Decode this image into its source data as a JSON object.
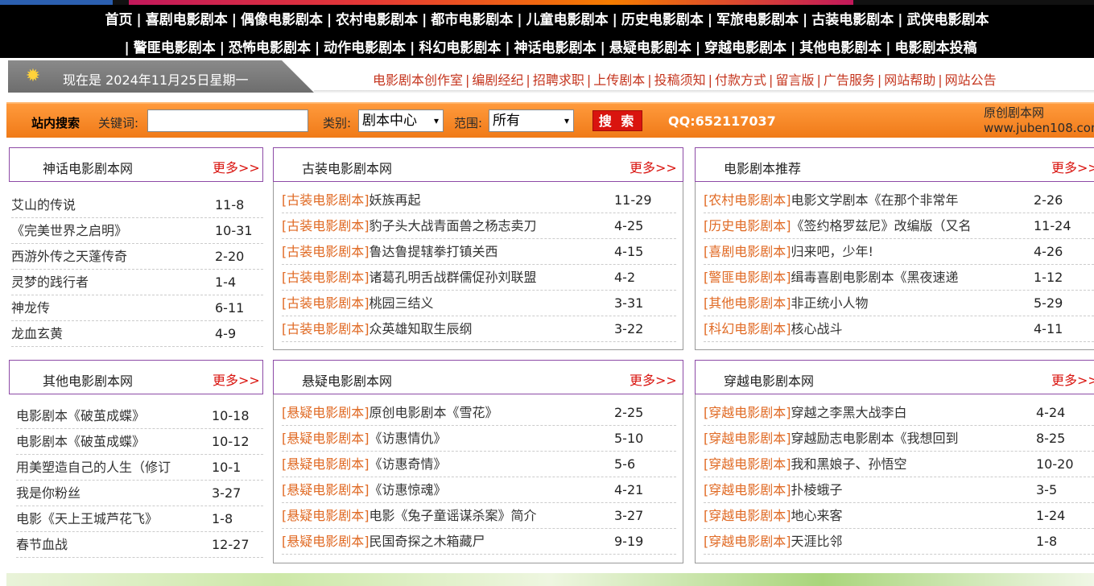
{
  "nav": {
    "row1": [
      "首页",
      "喜剧电影剧本",
      "偶像电影剧本",
      "农村电影剧本",
      "都市电影剧本",
      "儿童电影剧本",
      "历史电影剧本",
      "军旅电影剧本",
      "古装电影剧本",
      "武侠电影剧本"
    ],
    "row2": [
      "警匪电影剧本",
      "恐怖电影剧本",
      "动作电影剧本",
      "科幻电影剧本",
      "神话电影剧本",
      "悬疑电影剧本",
      "穿越电影剧本",
      "其他电影剧本",
      "电影剧本投稿"
    ]
  },
  "datebar": {
    "date_text": "现在是 2024年11月25日星期一",
    "links": [
      "电影剧本创作室",
      "编剧经纪",
      "招聘求职",
      "上传剧本",
      "投稿须知",
      "付款方式",
      "留言版",
      "广告服务",
      "网站帮助",
      "网站公告"
    ]
  },
  "search": {
    "site_search_label": "站内搜索",
    "keyword_label": "关键词:",
    "keyword_value": "",
    "category_label": "类别:",
    "category_value": "剧本中心",
    "scope_label": "范围:",
    "scope_value": "所有",
    "button_label": "搜 索",
    "qq": "QQ:652117037",
    "site_name": "原创剧本网",
    "site_url": "www.juben108.com"
  },
  "boxes": {
    "shenhua": {
      "title": "神话电影剧本网",
      "more": "更多>>",
      "items": [
        {
          "title": "艾山的传说",
          "date": "11-8"
        },
        {
          "title": "《完美世界之启明》",
          "date": "10-31"
        },
        {
          "title": "西游外传之天蓬传奇",
          "date": "2-20"
        },
        {
          "title": "灵梦的践行者",
          "date": "1-4"
        },
        {
          "title": "神龙传",
          "date": "6-11"
        },
        {
          "title": "龙血玄黄",
          "date": "4-9"
        }
      ]
    },
    "guzhuang": {
      "title": "古装电影剧本网",
      "more": "更多>>",
      "items": [
        {
          "cat": "[古装电影剧本]",
          "title": "妖族再起",
          "date": "11-29"
        },
        {
          "cat": "[古装电影剧本]",
          "title": "豹子头大战青面兽之杨志卖刀",
          "date": "4-25"
        },
        {
          "cat": "[古装电影剧本]",
          "title": "鲁达鲁提辖拳打镇关西",
          "date": "4-15"
        },
        {
          "cat": "[古装电影剧本]",
          "title": "诸葛孔明舌战群儒促孙刘联盟",
          "date": "4-2"
        },
        {
          "cat": "[古装电影剧本]",
          "title": "桃园三结义",
          "date": "3-31"
        },
        {
          "cat": "[古装电影剧本]",
          "title": "众英雄知取生辰纲",
          "date": "3-22"
        }
      ]
    },
    "tuijian": {
      "title": "电影剧本推荐",
      "more": "更多>>",
      "items": [
        {
          "cat": "[农村电影剧本]",
          "title": "电影文学剧本《在那个非常年",
          "date": "2-26"
        },
        {
          "cat": "[历史电影剧本]",
          "title": "《签约格罗兹尼》改编版（又名",
          "date": "11-24"
        },
        {
          "cat": "[喜剧电影剧本]",
          "title": "归来吧，少年!",
          "date": "4-26"
        },
        {
          "cat": "[警匪电影剧本]",
          "title": "缉毒喜剧电影剧本《黑夜速递",
          "date": "1-12"
        },
        {
          "cat": "[其他电影剧本]",
          "title": "非正统小人物",
          "date": "5-29"
        },
        {
          "cat": "[科幻电影剧本]",
          "title": "核心战斗",
          "date": "4-11"
        }
      ]
    },
    "qita": {
      "title": "其他电影剧本网",
      "more": "更多>>",
      "items": [
        {
          "title": "电影剧本《破茧成蝶》",
          "date": "10-18"
        },
        {
          "title": "电影剧本《破茧成蝶》",
          "date": "10-12"
        },
        {
          "title": "用美塑造自己的人生（修订",
          "date": "10-1"
        },
        {
          "title": "我是你粉丝",
          "date": "3-27"
        },
        {
          "title": "电影《天上王城芦花飞》",
          "date": "1-8"
        },
        {
          "title": "春节血战",
          "date": "12-27"
        }
      ]
    },
    "xuanyi": {
      "title": "悬疑电影剧本网",
      "more": "更多>>",
      "items": [
        {
          "cat": "[悬疑电影剧本]",
          "title": "原创电影剧本《雪花》",
          "date": "2-25"
        },
        {
          "cat": "[悬疑电影剧本]",
          "title": "《访惠情仇》",
          "date": "5-10"
        },
        {
          "cat": "[悬疑电影剧本]",
          "title": "《访惠奇情》",
          "date": "5-6"
        },
        {
          "cat": "[悬疑电影剧本]",
          "title": "《访惠惊魂》",
          "date": "4-21"
        },
        {
          "cat": "[悬疑电影剧本]",
          "title": "电影《兔子童谣谋杀案》简介",
          "date": "3-27"
        },
        {
          "cat": "[悬疑电影剧本]",
          "title": "民国奇探之木箱藏尸",
          "date": "9-19"
        }
      ]
    },
    "chuanyue": {
      "title": "穿越电影剧本网",
      "more": "更多>>",
      "items": [
        {
          "cat": "[穿越电影剧本]",
          "title": "穿越之李黑大战李白",
          "date": "4-24"
        },
        {
          "cat": "[穿越电影剧本]",
          "title": "穿越励志电影剧本《我想回到",
          "date": "8-25"
        },
        {
          "cat": "[穿越电影剧本]",
          "title": "我和黑娘子、孙悟空",
          "date": "10-20"
        },
        {
          "cat": "[穿越电影剧本]",
          "title": "扑棱蛾子",
          "date": "3-5"
        },
        {
          "cat": "[穿越电影剧本]",
          "title": "地心来客",
          "date": "1-24"
        },
        {
          "cat": "[穿越电影剧本]",
          "title": "天涯比邻",
          "date": "1-8"
        }
      ]
    }
  },
  "colors": {
    "nav_bg": "#000000",
    "search_bar": "#f07a18",
    "box_border": "#8d4aa6",
    "link_red": "#d9140f",
    "category_orange": "#e06a24"
  }
}
